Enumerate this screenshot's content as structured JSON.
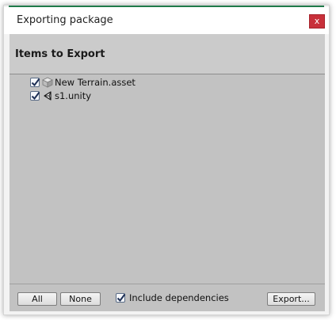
{
  "window": {
    "title": "Exporting package",
    "close_glyph": "x",
    "accent_color": "#1f7a4a",
    "close_color": "#c8303a"
  },
  "header": {
    "title": "Items to Export"
  },
  "items": [
    {
      "label": "New Terrain.asset",
      "checked": true,
      "icon": "terrain-asset-icon"
    },
    {
      "label": "s1.unity",
      "checked": true,
      "icon": "unity-scene-icon"
    }
  ],
  "footer": {
    "all_label": "All",
    "none_label": "None",
    "include_dependencies_label": "Include dependencies",
    "include_dependencies_checked": true,
    "export_label": "Export..."
  }
}
